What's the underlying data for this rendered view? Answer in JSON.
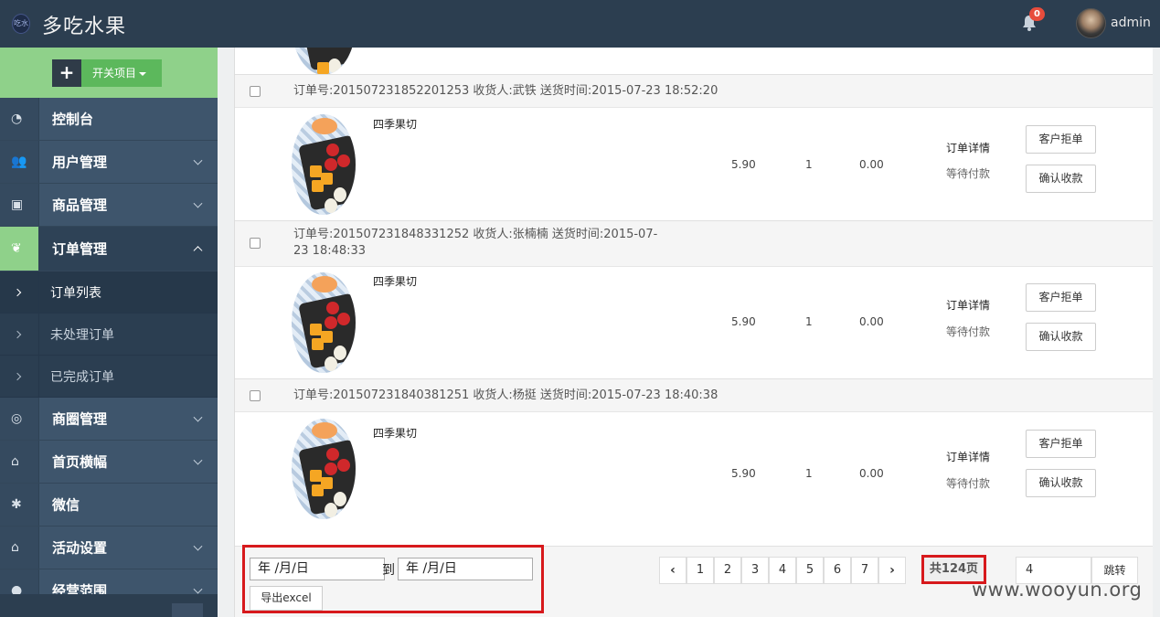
{
  "header": {
    "title": "多吃水果",
    "logo_text": "吃水",
    "notification_count": "0",
    "user": "admin"
  },
  "sidebar": {
    "toggle_label": "开关项目",
    "items": [
      {
        "label": "控制台",
        "icon": "dashboard-icon"
      },
      {
        "label": "用户管理",
        "icon": "users-icon"
      },
      {
        "label": "商品管理",
        "icon": "briefcase-icon"
      },
      {
        "label": "订单管理",
        "icon": "leaf-icon"
      },
      {
        "label": "商圈管理",
        "icon": "target-icon"
      },
      {
        "label": "首页横幅",
        "icon": "home-icon"
      },
      {
        "label": "微信",
        "icon": "asterisk-icon"
      },
      {
        "label": "活动设置",
        "icon": "home-icon"
      },
      {
        "label": "经营范围",
        "icon": "map-marker-icon"
      }
    ],
    "sub_items": [
      {
        "label": "订单列表"
      },
      {
        "label": "未处理订单"
      },
      {
        "label": "已完成订单"
      }
    ]
  },
  "orders": [
    {
      "meta": "订单号:201507231852201253   收货人:武铁   送货时间:2015-07-23 18:52:20",
      "product": "四季果切",
      "price": "5.90",
      "qty": "1",
      "discount": "0.00",
      "detail": "订单详情",
      "status": "等待付款",
      "reject": "客户拒单",
      "confirm": "确认收款"
    },
    {
      "meta": "订单号:201507231848331252   收货人:张楠楠   送货时间:2015-07-23 18:48:33",
      "product": "四季果切",
      "price": "5.90",
      "qty": "1",
      "discount": "0.00",
      "detail": "订单详情",
      "status": "等待付款",
      "reject": "客户拒单",
      "confirm": "确认收款"
    },
    {
      "meta": "订单号:201507231840381251   收货人:杨挺   送货时间:2015-07-23 18:40:38",
      "product": "四季果切",
      "price": "5.90",
      "qty": "1",
      "discount": "0.00",
      "detail": "订单详情",
      "status": "等待付款",
      "reject": "客户拒单",
      "confirm": "确认收款"
    }
  ],
  "footer": {
    "date_from": "年 /月/日",
    "to": "到",
    "date_to": "年 /月/日",
    "export_label": "导出excel",
    "pages": [
      "1",
      "2",
      "3",
      "4",
      "5",
      "6",
      "7"
    ],
    "prev": "‹",
    "next": "›",
    "total": "共124页",
    "jump_value": "4",
    "jump_label": "跳转"
  },
  "watermark": "www.wooyun.org"
}
